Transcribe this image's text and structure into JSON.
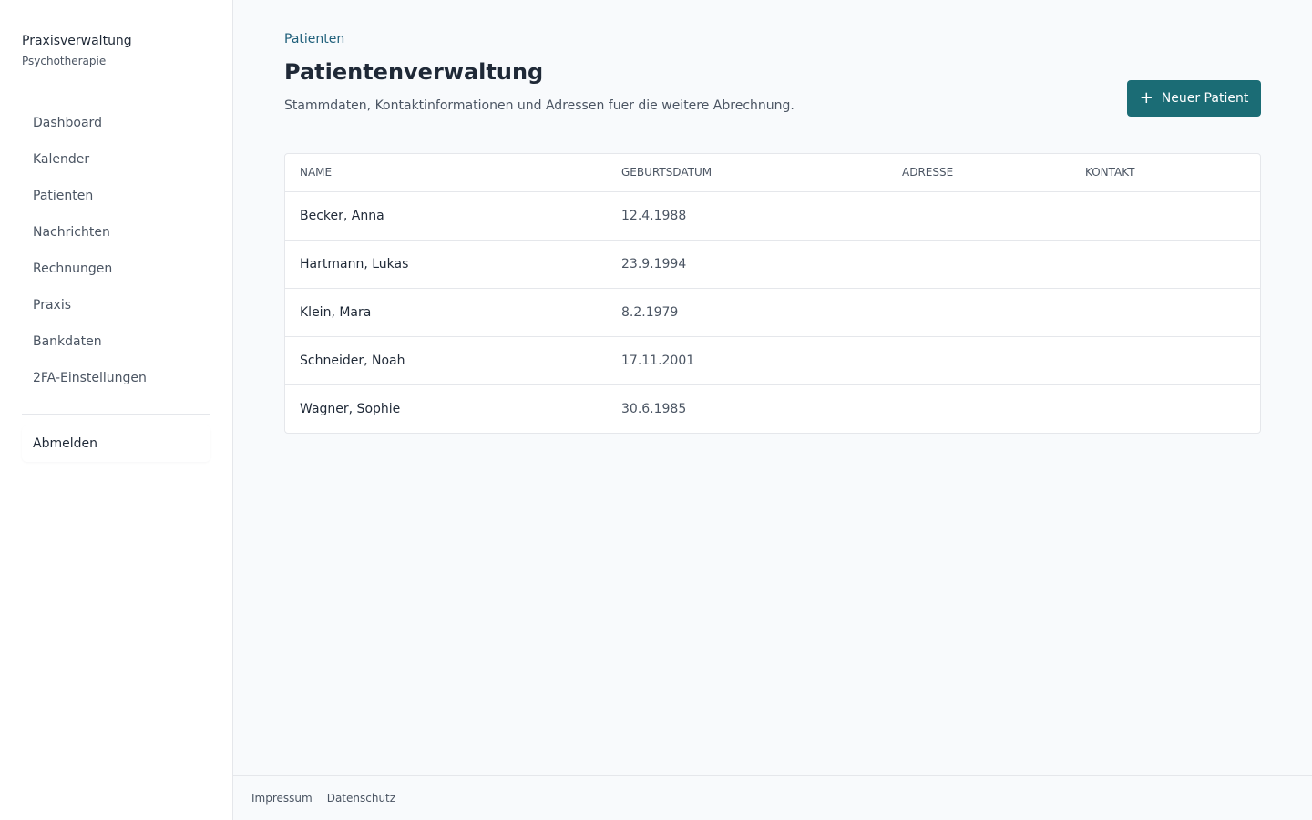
{
  "brand": {
    "title": "Praxisverwaltung",
    "subtitle": "Psychotherapie"
  },
  "sidebar": {
    "items": [
      {
        "label": "Dashboard"
      },
      {
        "label": "Kalender"
      },
      {
        "label": "Patienten"
      },
      {
        "label": "Nachrichten"
      },
      {
        "label": "Rechnungen"
      },
      {
        "label": "Praxis"
      },
      {
        "label": "Bankdaten"
      },
      {
        "label": "2FA-Einstellungen"
      }
    ],
    "logout_label": "Abmelden"
  },
  "header": {
    "breadcrumb": "Patienten",
    "title": "Patientenverwaltung",
    "description": "Stammdaten, Kontaktinformationen und Adressen fuer die weitere Abrechnung.",
    "new_button_label": "Neuer Patient",
    "new_button_icon": "plus-icon"
  },
  "table": {
    "columns": [
      "NAME",
      "GEBURTSDATUM",
      "ADRESSE",
      "KONTAKT"
    ],
    "rows": [
      {
        "name": "Becker, Anna",
        "birthdate": "12.4.1988",
        "address": "",
        "contact": ""
      },
      {
        "name": "Hartmann, Lukas",
        "birthdate": "23.9.1994",
        "address": "",
        "contact": ""
      },
      {
        "name": "Klein, Mara",
        "birthdate": "8.2.1979",
        "address": "",
        "contact": ""
      },
      {
        "name": "Schneider, Noah",
        "birthdate": "17.11.2001",
        "address": "",
        "contact": ""
      },
      {
        "name": "Wagner, Sophie",
        "birthdate": "30.6.1985",
        "address": "",
        "contact": ""
      }
    ]
  },
  "footer": {
    "impressum": "Impressum",
    "datenschutz": "Datenschutz"
  },
  "colors": {
    "accent": "#1b6c75",
    "breadcrumb": "#1f5f7a",
    "background": "#f8fafc"
  }
}
